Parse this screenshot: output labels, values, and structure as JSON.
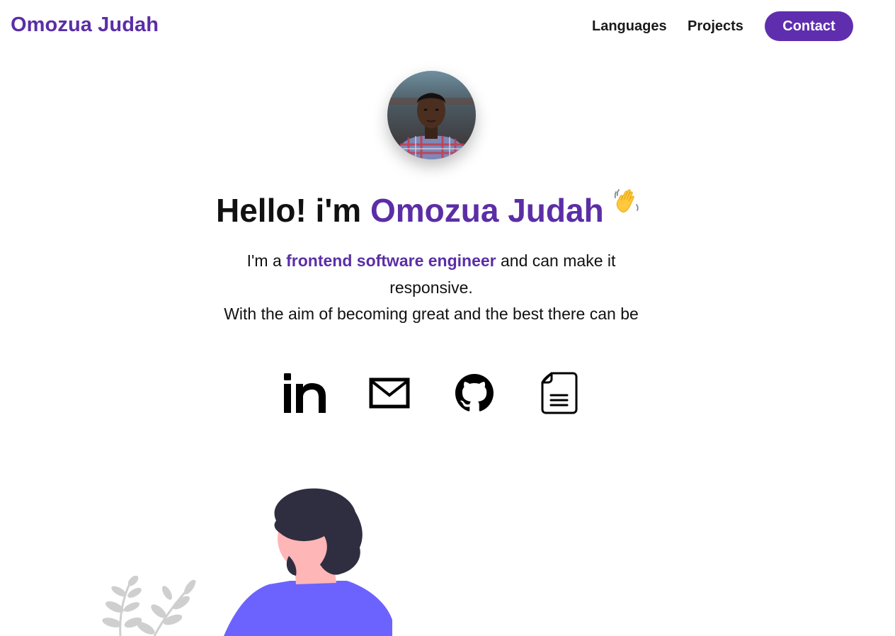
{
  "header": {
    "brand": "Omozua Judah",
    "nav": {
      "languages": "Languages",
      "projects": "Projects",
      "contact": "Contact"
    }
  },
  "hero": {
    "greeting": "Hello! i'm ",
    "name": "Omozua Judah",
    "bio": {
      "line1_prefix": "I'm a ",
      "line1_highlight": "frontend software engineer",
      "line1_suffix": " and can make it responsive.",
      "line2": "With the aim of becoming great and the best there can be"
    }
  },
  "social": [
    "linkedin-icon",
    "mail-icon",
    "github-icon",
    "document-icon"
  ],
  "colors": {
    "brand": "#5b2ea6",
    "contact_button": "#5f2eae",
    "illustration_shirt": "#6c63ff",
    "illustration_hair": "#2f2e41",
    "illustration_skin": "#ffb6b6",
    "leaves": "#cfcfcf"
  }
}
